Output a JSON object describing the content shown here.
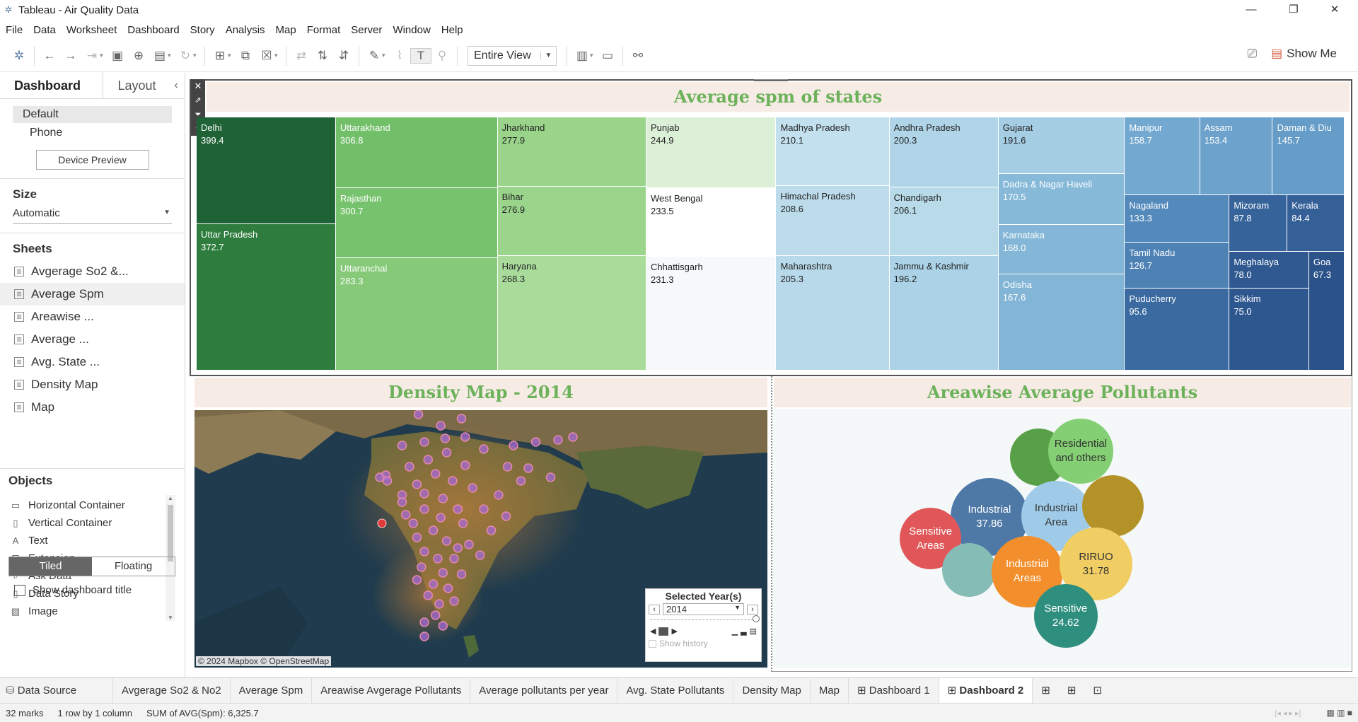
{
  "window": {
    "title": "Tableau - Air Quality Data",
    "min": "—",
    "max": "❐",
    "close": "✕"
  },
  "menu": [
    "File",
    "Data",
    "Worksheet",
    "Dashboard",
    "Story",
    "Analysis",
    "Map",
    "Format",
    "Server",
    "Window",
    "Help"
  ],
  "toolbar": {
    "fit": "Entire View",
    "show_me": "Show Me"
  },
  "sidebar": {
    "tab_dashboard": "Dashboard",
    "tab_layout": "Layout",
    "device_default": "Default",
    "device_phone": "Phone",
    "device_preview": "Device Preview",
    "size_label": "Size",
    "size_value": "Automatic",
    "sheets_label": "Sheets",
    "sheets": [
      "Avgerage So2 &...",
      "Average Spm",
      "Areawise ...",
      "Average ...",
      "Avg. State ...",
      "Density Map",
      "Map"
    ],
    "objects_label": "Objects",
    "objects": [
      "Horizontal Container",
      "Vertical Container",
      "Text",
      "Extension",
      "Ask Data",
      "Data Story",
      "Image"
    ],
    "tiled": "Tiled",
    "floating": "Floating",
    "show_title": "Show dashboard title"
  },
  "dashboard": {
    "treemap_title": "Average spm of states",
    "map_title": "Density Map - 2014",
    "bubble_title": "Areawise Average Pollutants",
    "map_attribution": "© 2024 Mapbox © OpenStreetMap",
    "year_filter": {
      "label": "Selected Year(s)",
      "value": "2014",
      "show_history": "Show history"
    }
  },
  "treemap": [
    {
      "name": "Delhi",
      "value": "399.4",
      "color": "#1e6235"
    },
    {
      "name": "Uttar Pradesh",
      "value": "372.7",
      "color": "#2e7d3e"
    },
    {
      "name": "Uttarakhand",
      "value": "306.8",
      "color": "#72bf6a"
    },
    {
      "name": "Rajasthan",
      "value": "300.7",
      "color": "#77c36d"
    },
    {
      "name": "Uttaranchal",
      "value": "283.3",
      "color": "#86c979"
    },
    {
      "name": "Jharkhand",
      "value": "277.9",
      "color": "#99d48a"
    },
    {
      "name": "Bihar",
      "value": "276.9",
      "color": "#9ad58b"
    },
    {
      "name": "Haryana",
      "value": "268.3",
      "color": "#a9dc9b"
    },
    {
      "name": "Punjab",
      "value": "244.9",
      "color": "#dcf0d8"
    },
    {
      "name": "West Bengal",
      "value": "233.5",
      "color": "#ffffff"
    },
    {
      "name": "Chhattisgarh",
      "value": "231.3",
      "color": "#f5f9fc"
    },
    {
      "name": "Madhya Pradesh",
      "value": "210.1",
      "color": "#c3e0ef"
    },
    {
      "name": "Himachal Pradesh",
      "value": "208.6",
      "color": "#bcdcec"
    },
    {
      "name": "Chandigarh",
      "value": "206.1",
      "color": "#b8dae9"
    },
    {
      "name": "Maharashtra",
      "value": "205.3",
      "color": "#b7d9ea"
    },
    {
      "name": "Andhra Pradesh",
      "value": "200.3",
      "color": "#b1d5e8"
    },
    {
      "name": "Jammu & Kashmir",
      "value": "196.2",
      "color": "#abd2e6"
    },
    {
      "name": "Gujarat",
      "value": "191.6",
      "color": "#a5cde4"
    },
    {
      "name": "Dadra & Nagar Haveli",
      "value": "170.5",
      "color": "#87b9d9"
    },
    {
      "name": "Karnataka",
      "value": "168.0",
      "color": "#84b6d7"
    },
    {
      "name": "Odisha",
      "value": "167.6",
      "color": "#83b5d6"
    },
    {
      "name": "Manipur",
      "value": "158.7",
      "color": "#73a8d0"
    },
    {
      "name": "Assam",
      "value": "153.4",
      "color": "#6ca2cc"
    },
    {
      "name": "Daman & Diu",
      "value": "145.7",
      "color": "#659cc8"
    },
    {
      "name": "Nagaland",
      "value": "133.3",
      "color": "#5489bb"
    },
    {
      "name": "Tamil Nadu",
      "value": "126.7",
      "color": "#4e82b5"
    },
    {
      "name": "Puducherry",
      "value": "95.6",
      "color": "#3a6aa0"
    },
    {
      "name": "Mizoram",
      "value": "87.8",
      "color": "#36639a"
    },
    {
      "name": "Kerala",
      "value": "84.4",
      "color": "#345f97"
    },
    {
      "name": "Meghalaya",
      "value": "78.0",
      "color": "#305991"
    },
    {
      "name": "Sikkim",
      "value": "75.0",
      "color": "#2f578f"
    },
    {
      "name": "Goa",
      "value": "67.3",
      "color": "#2c528a"
    }
  ],
  "bubbles": [
    {
      "label": "",
      "value": "",
      "color": "#58a047"
    },
    {
      "label": "Residential and others",
      "value": "",
      "color": "#84cf73"
    },
    {
      "label": "Industrial",
      "value": "37.86",
      "color": "#4e79a7"
    },
    {
      "label": "Industrial Area",
      "value": "",
      "color": "#a0cbe8"
    },
    {
      "label": "",
      "value": "",
      "color": "#b39227"
    },
    {
      "label": "Sensitive Areas",
      "value": "",
      "color": "#e15759"
    },
    {
      "label": "",
      "value": "",
      "color": "#86bcb6"
    },
    {
      "label": "Industrial Areas",
      "value": "",
      "color": "#f28e2b"
    },
    {
      "label": "RIRUO",
      "value": "31.78",
      "color": "#f1ce63"
    },
    {
      "label": "Sensitive",
      "value": "24.62",
      "color": "#2f8f7f"
    }
  ],
  "bottom_tabs": [
    "Data Source",
    "Avgerage So2 & No2",
    "Average Spm",
    "Areawise Avgerage Pollutants",
    "Average pollutants per year",
    "Avg. State Pollutants",
    "Density Map",
    "Map",
    "Dashboard 1",
    "Dashboard 2"
  ],
  "status": {
    "marks": "32 marks",
    "rows": "1 row by 1 column",
    "sum": "SUM of AVG(Spm): 6,325.7"
  }
}
